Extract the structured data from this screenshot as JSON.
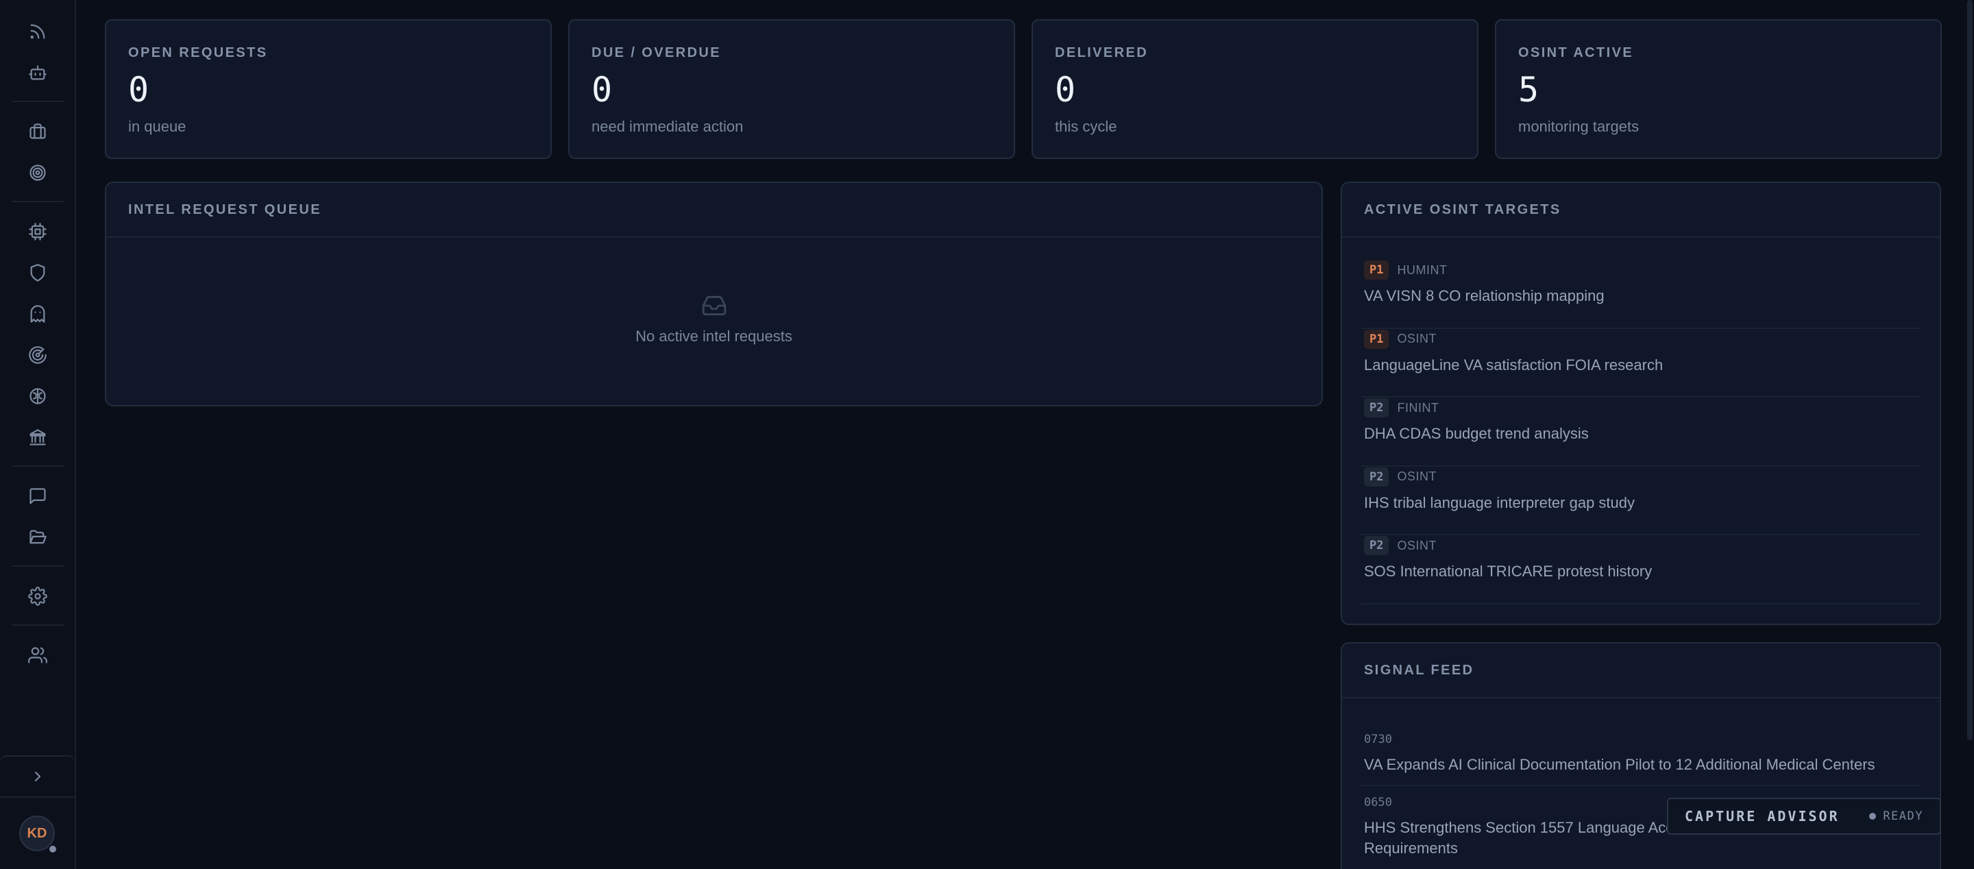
{
  "sidebar": {
    "avatar_initials": "KD",
    "icons": [
      "rss-icon",
      "bot-icon",
      "briefcase-icon",
      "target-icon",
      "cpu-icon",
      "shield-icon",
      "ghost-icon",
      "radar-icon",
      "brain-icon",
      "bank-icon",
      "message-icon",
      "folder-open-icon",
      "gear-icon",
      "users-icon",
      "chevron-right-icon"
    ]
  },
  "stats": [
    {
      "label": "OPEN REQUESTS",
      "value": "0",
      "sub": "in queue"
    },
    {
      "label": "DUE / OVERDUE",
      "value": "0",
      "sub": "need immediate action"
    },
    {
      "label": "DELIVERED",
      "value": "0",
      "sub": "this cycle"
    },
    {
      "label": "OSINT ACTIVE",
      "value": "5",
      "sub": "monitoring targets"
    }
  ],
  "queue": {
    "title": "INTEL REQUEST QUEUE",
    "empty_text": "No active intel requests"
  },
  "targets": {
    "title": "ACTIVE OSINT TARGETS",
    "items": [
      {
        "priority": "P1",
        "type": "HUMINT",
        "title": "VA VISN 8 CO relationship mapping"
      },
      {
        "priority": "P1",
        "type": "OSINT",
        "title": "LanguageLine VA satisfaction FOIA research"
      },
      {
        "priority": "P2",
        "type": "FININT",
        "title": "DHA CDAS budget trend analysis"
      },
      {
        "priority": "P2",
        "type": "OSINT",
        "title": "IHS tribal language interpreter gap study"
      },
      {
        "priority": "P2",
        "type": "OSINT",
        "title": "SOS International TRICARE protest history"
      }
    ]
  },
  "feed": {
    "title": "SIGNAL FEED",
    "items": [
      {
        "time": "0730",
        "title": "VA Expands AI Clinical Documentation Pilot to 12 Additional Medical Centers"
      },
      {
        "time": "0650",
        "title": "HHS Strengthens Section 1557 Language Access Requirements"
      }
    ]
  },
  "advisor": {
    "title": "CAPTURE ADVISOR",
    "status": "READY"
  },
  "colors": {
    "background": "#0a0e18",
    "card": "#0f1728",
    "border": "#232d3f",
    "p1_accent": "#e18757",
    "avatar_accent": "#d9814e"
  }
}
